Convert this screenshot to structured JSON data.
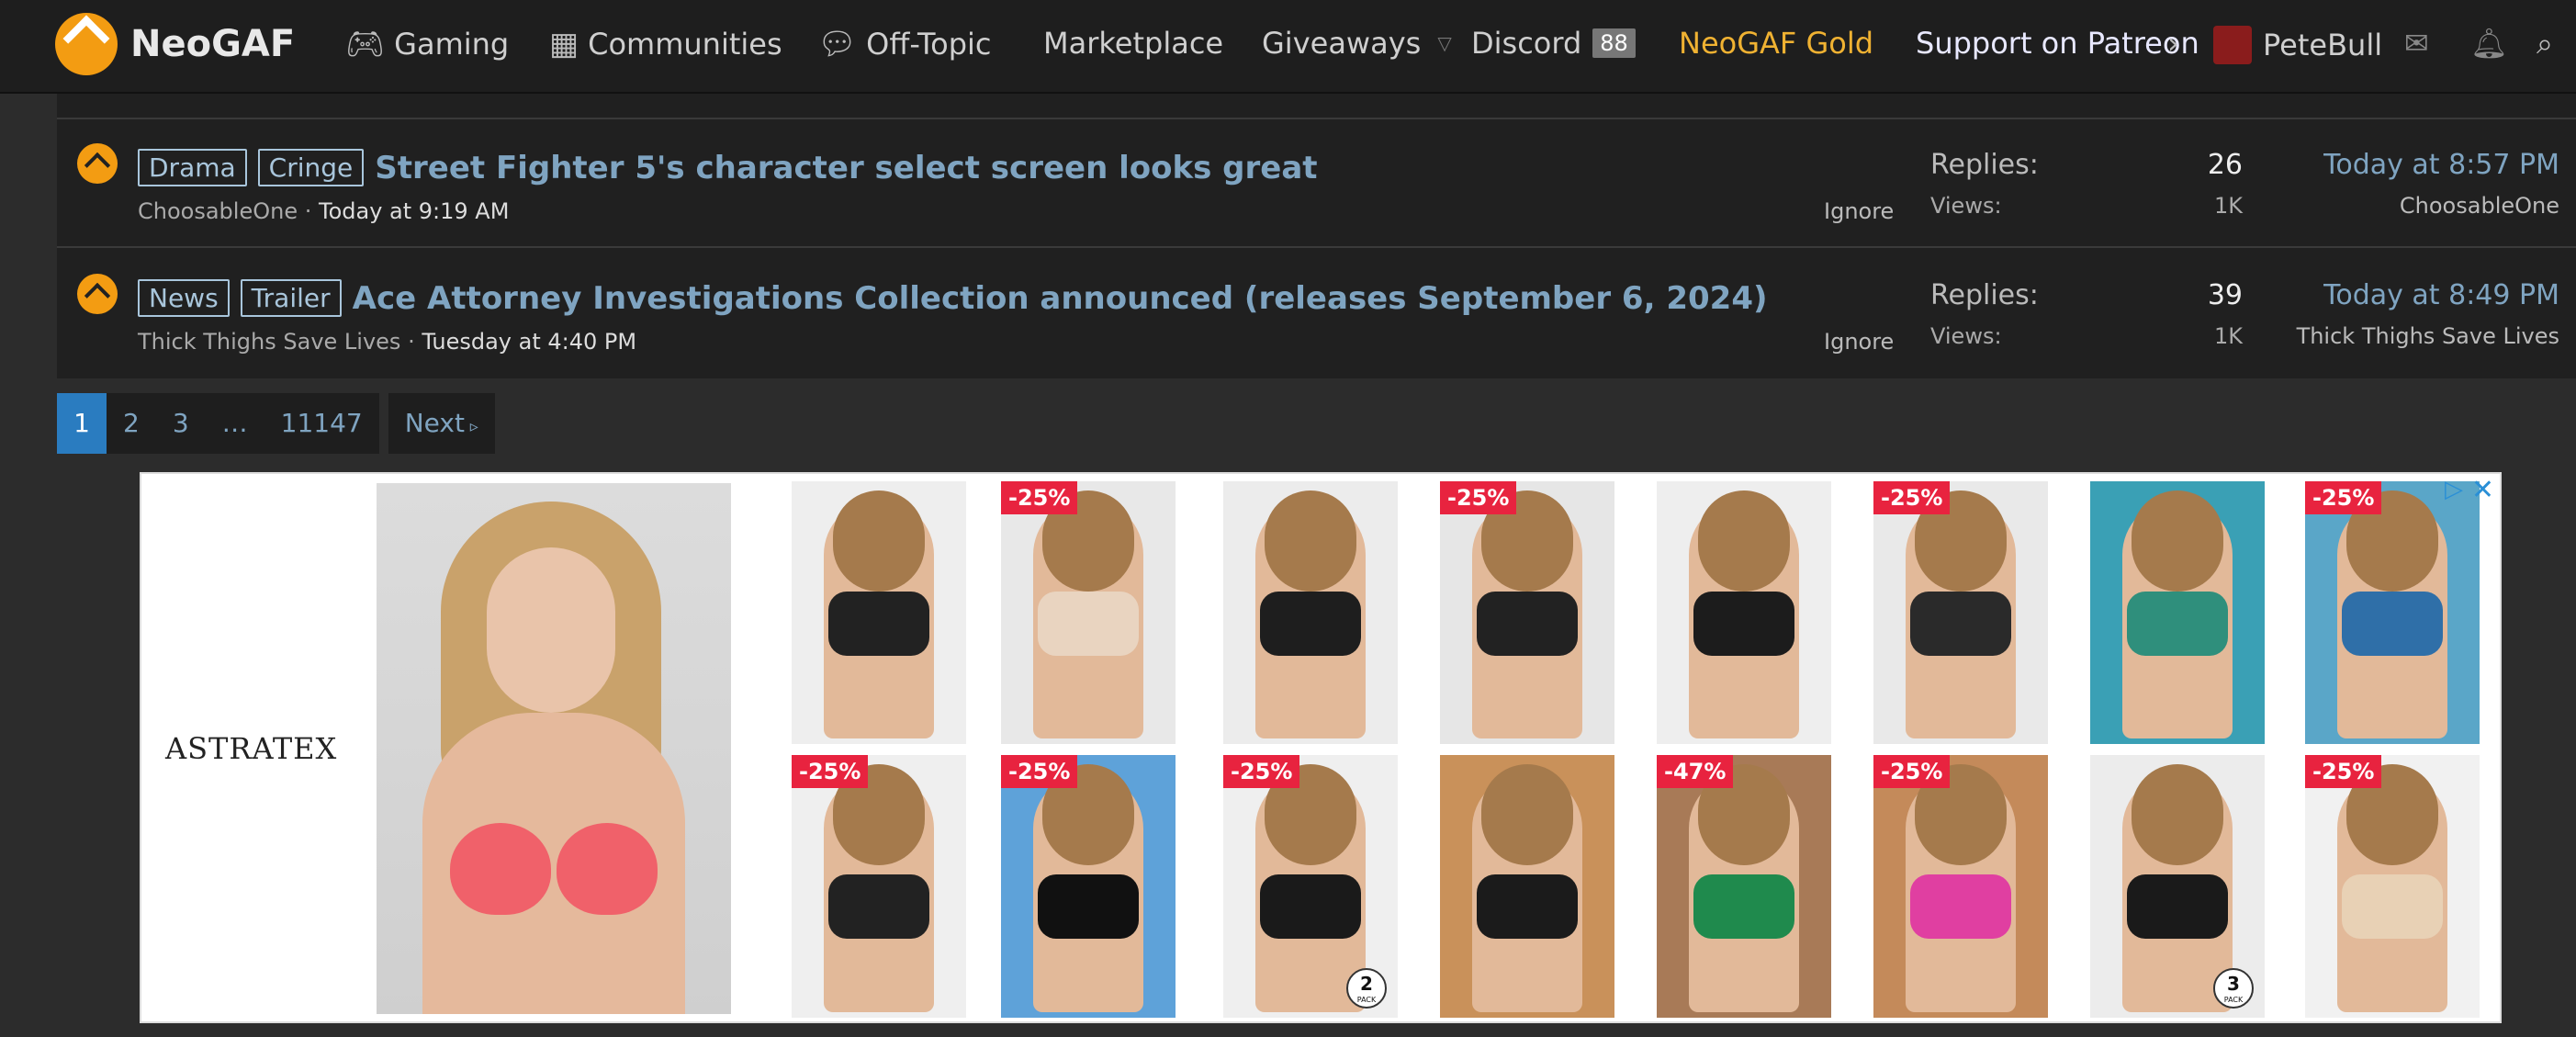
{
  "nav": {
    "brand": "NeoGAF",
    "items": [
      {
        "label": "Gaming",
        "icon": "gamepad-icon"
      },
      {
        "label": "Communities",
        "icon": "building-icon"
      },
      {
        "label": "Off-Topic",
        "icon": "chat-bubbles-icon"
      },
      {
        "label": "Marketplace"
      },
      {
        "label": "Giveaways",
        "icon": "chevron-down-icon"
      },
      {
        "label": "Discord",
        "badge": "88"
      },
      {
        "label": "NeoGAF Gold",
        "color": "#f0b232"
      },
      {
        "label": "Support on Patreon"
      }
    ],
    "user": "PeteBull"
  },
  "threads": [
    {
      "tags": [
        "Drama",
        "Cringe"
      ],
      "title": "Street Fighter 5's character select screen looks great",
      "author": "ChoosableOne",
      "started": "Today at 9:19 AM",
      "ignore": "Ignore",
      "replies_label": "Replies:",
      "replies": "26",
      "views_label": "Views:",
      "views": "1K",
      "last_time": "Today at 8:57 PM",
      "last_user": "ChoosableOne"
    },
    {
      "tags": [
        "News",
        "Trailer"
      ],
      "title": "Ace Attorney Investigations Collection announced (releases September 6, 2024)",
      "author": "Thick Thighs Save Lives",
      "started": "Tuesday at 4:40 PM",
      "ignore": "Ignore",
      "replies_label": "Replies:",
      "replies": "39",
      "views_label": "Views:",
      "views": "1K",
      "last_time": "Today at 8:49 PM",
      "last_user": "Thick Thighs Save Lives"
    }
  ],
  "pagination": {
    "pages": [
      "1",
      "2",
      "3",
      "…",
      "11147"
    ],
    "current": "1",
    "next": "Next"
  },
  "ad": {
    "brand": "ASTRATEX",
    "close": "✕",
    "choices": "▷",
    "products_top": [
      {
        "discount": ""
      },
      {
        "discount": "-25%"
      },
      {
        "discount": ""
      },
      {
        "discount": "-25%"
      },
      {
        "discount": ""
      },
      {
        "discount": "-25%"
      },
      {
        "discount": ""
      },
      {
        "discount": "-25%"
      }
    ],
    "products_bottom": [
      {
        "discount": "-25%"
      },
      {
        "discount": "-25%"
      },
      {
        "discount": "-25%",
        "pack": "2",
        "pack_label": "PACK"
      },
      {
        "discount": ""
      },
      {
        "discount": "-47%"
      },
      {
        "discount": "-25%"
      },
      {
        "discount": "",
        "pack": "3",
        "pack_label": "PACK"
      },
      {
        "discount": "-25%"
      }
    ]
  }
}
